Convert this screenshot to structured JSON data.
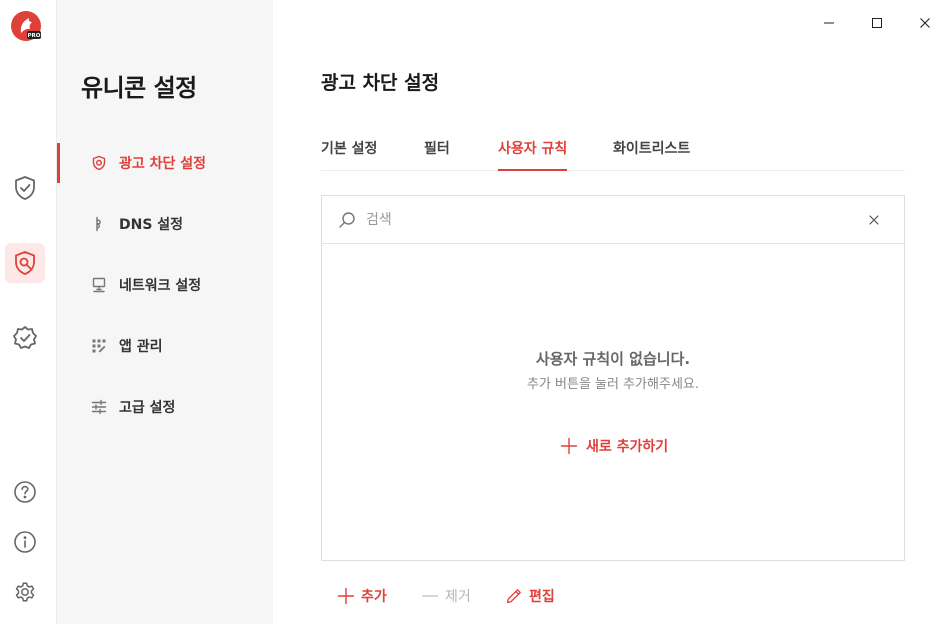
{
  "app": {
    "logo_badge": "PRO"
  },
  "rail": {
    "items": [
      {
        "name": "protection",
        "icon": "shield-check-icon"
      },
      {
        "name": "settings",
        "icon": "shield-wrench-icon",
        "active": true
      },
      {
        "name": "verified",
        "icon": "badge-check-icon"
      }
    ],
    "bottom": [
      {
        "name": "help",
        "icon": "question-icon"
      },
      {
        "name": "info",
        "icon": "info-icon"
      },
      {
        "name": "preferences",
        "icon": "gear-icon"
      }
    ]
  },
  "nav": {
    "title": "유니콘 설정",
    "items": [
      {
        "label": "광고 차단 설정",
        "icon": "shield-icon",
        "active": true
      },
      {
        "label": "DNS 설정",
        "icon": "dns-icon"
      },
      {
        "label": "네트워크 설정",
        "icon": "network-icon"
      },
      {
        "label": "앱 관리",
        "icon": "apps-icon"
      },
      {
        "label": "고급 설정",
        "icon": "sliders-icon"
      }
    ]
  },
  "main": {
    "title": "광고 차단 설정",
    "tabs": [
      {
        "label": "기본 설정"
      },
      {
        "label": "필터"
      },
      {
        "label": "사용자 규칙",
        "active": true
      },
      {
        "label": "화이트리스트"
      }
    ],
    "search": {
      "placeholder": "검색",
      "value": ""
    },
    "empty": {
      "title": "사용자 규칙이 없습니다.",
      "subtitle": "추가 버튼을 눌러 추가해주세요.",
      "add_label": "새로 추가하기"
    },
    "actions": {
      "add": "추가",
      "remove": "제거",
      "edit": "편집"
    }
  },
  "colors": {
    "accent": "#e0403a",
    "nav_bg": "#f6f6f6",
    "active_bg": "#fde8e8"
  }
}
